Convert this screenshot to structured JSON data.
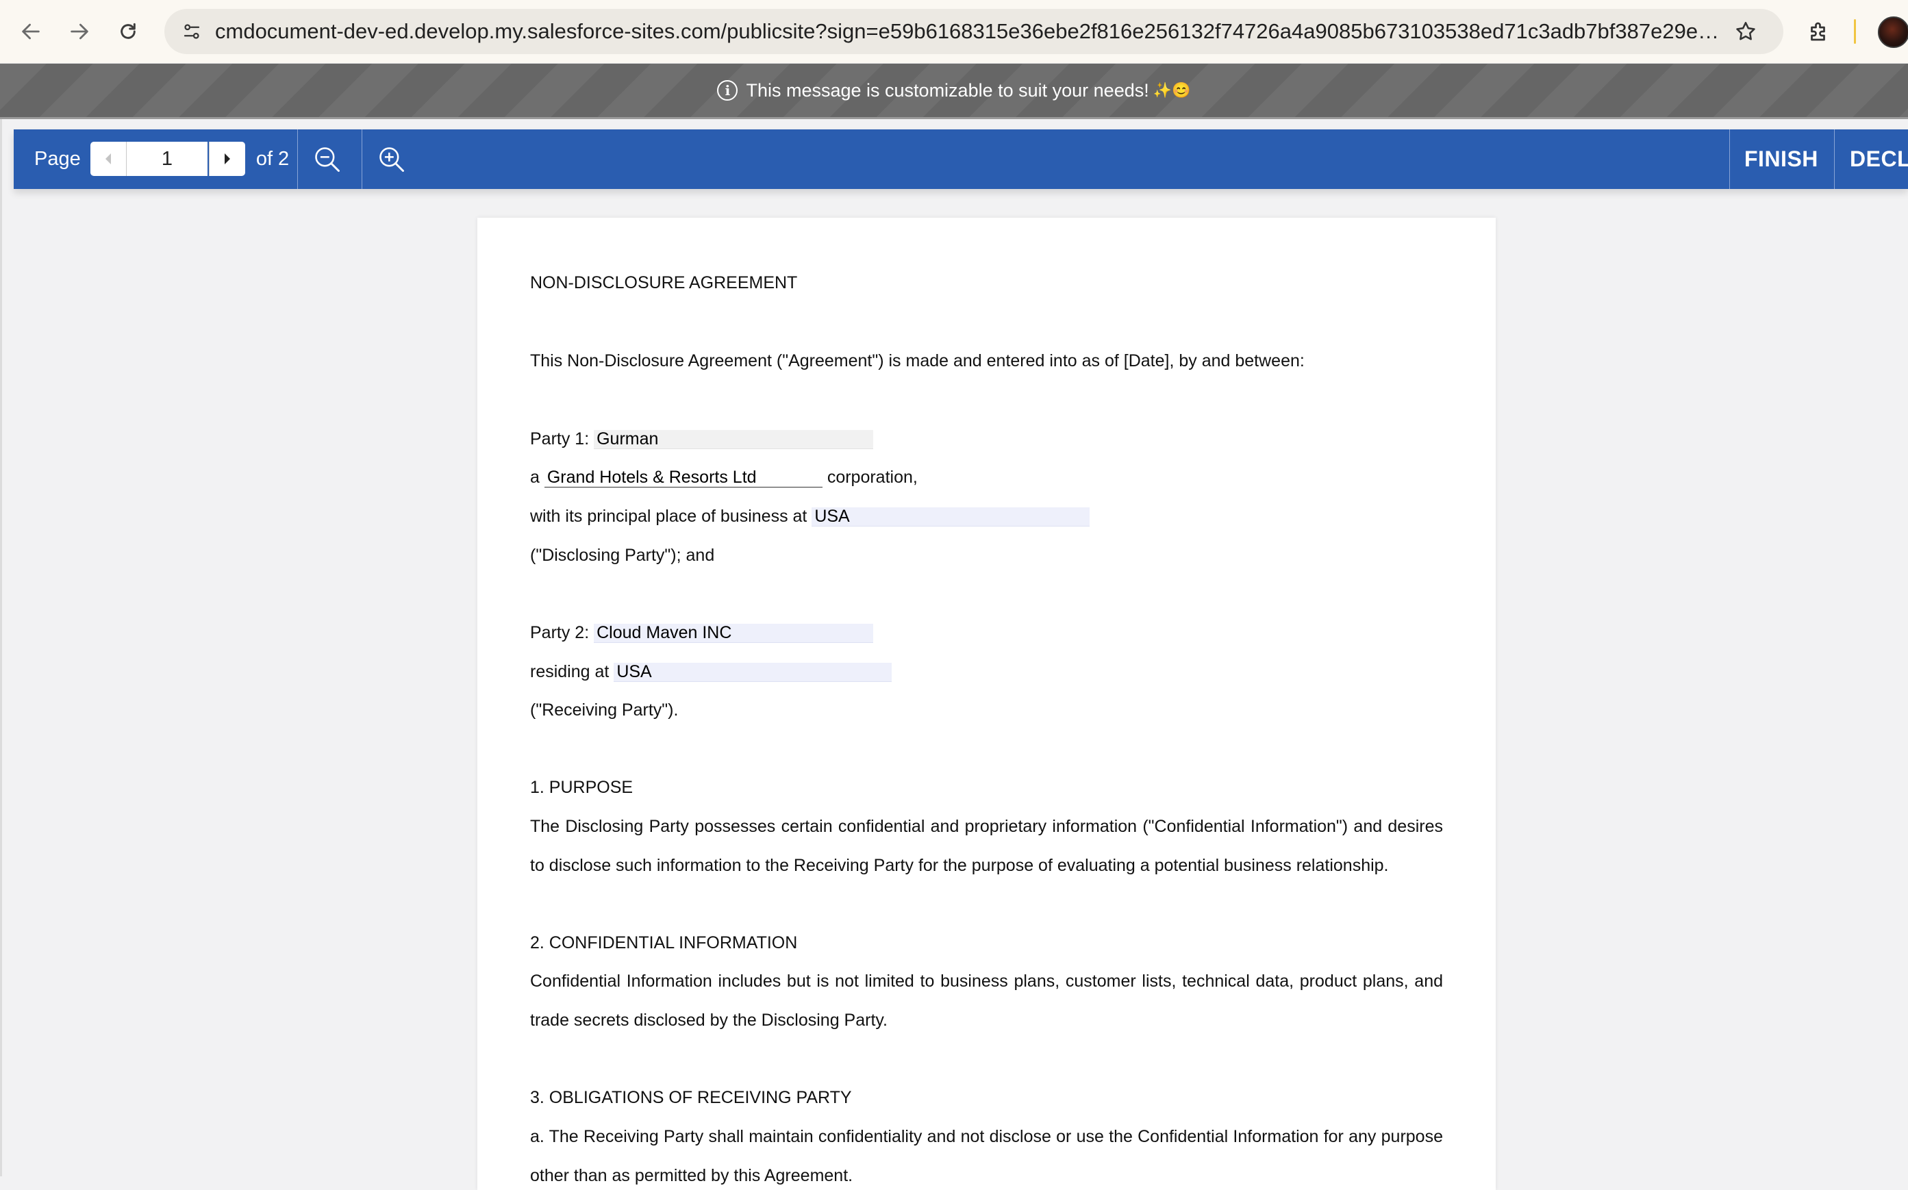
{
  "browser": {
    "url": "cmdocument-dev-ed.develop.my.salesforce-sites.com/publicsite?sign=e59b6168315e36ebe2f816e256132f74726a4a9085b673103538ed71c3adb7bf387e29ed30..."
  },
  "banner": {
    "message": "This message is customizable to suit your needs!",
    "emoji": "✨😊"
  },
  "toolbar": {
    "page_label": "Page",
    "current_page": "1",
    "of_label": "of 2",
    "finish_label": "FINISH",
    "decline_label": "DECL"
  },
  "document": {
    "title": "NON-DISCLOSURE AGREEMENT",
    "intro": "This Non-Disclosure Agreement (\"Agreement\") is made and entered into as of [Date], by and between:",
    "party1_label": "Party 1:",
    "party1_name": "Gurman",
    "party1_a": "a",
    "party1_company": "Grand Hotels & Resorts Ltd",
    "party1_corporation": "corporation,",
    "party1_business_label": "with its principal place of business at",
    "party1_business": "USA",
    "party1_role": "(\"Disclosing Party\"); and",
    "party2_label": "Party 2:",
    "party2_name": "Cloud Maven INC",
    "party2_residing_label": "residing at",
    "party2_residing": "USA",
    "party2_role": "(\"Receiving Party\").",
    "s1_heading": "1. PURPOSE",
    "s1_line1": "The Disclosing Party possesses certain confidential and proprietary information (\"Confidential Information\") and desires",
    "s1_line2": "to disclose such information to the Receiving Party for the purpose of evaluating a potential business relationship.",
    "s2_heading": "2. CONFIDENTIAL INFORMATION",
    "s2_line1": "Confidential Information includes but is not limited to business plans, customer lists, technical data, product plans, and",
    "s2_line2": "trade secrets disclosed by the Disclosing Party.",
    "s3_heading": "3. OBLIGATIONS OF RECEIVING PARTY",
    "s3_line1": "a. The Receiving Party shall maintain confidentiality and not disclose or use the Confidential Information for any purpose",
    "s3_line2": "other than as permitted by this Agreement."
  }
}
